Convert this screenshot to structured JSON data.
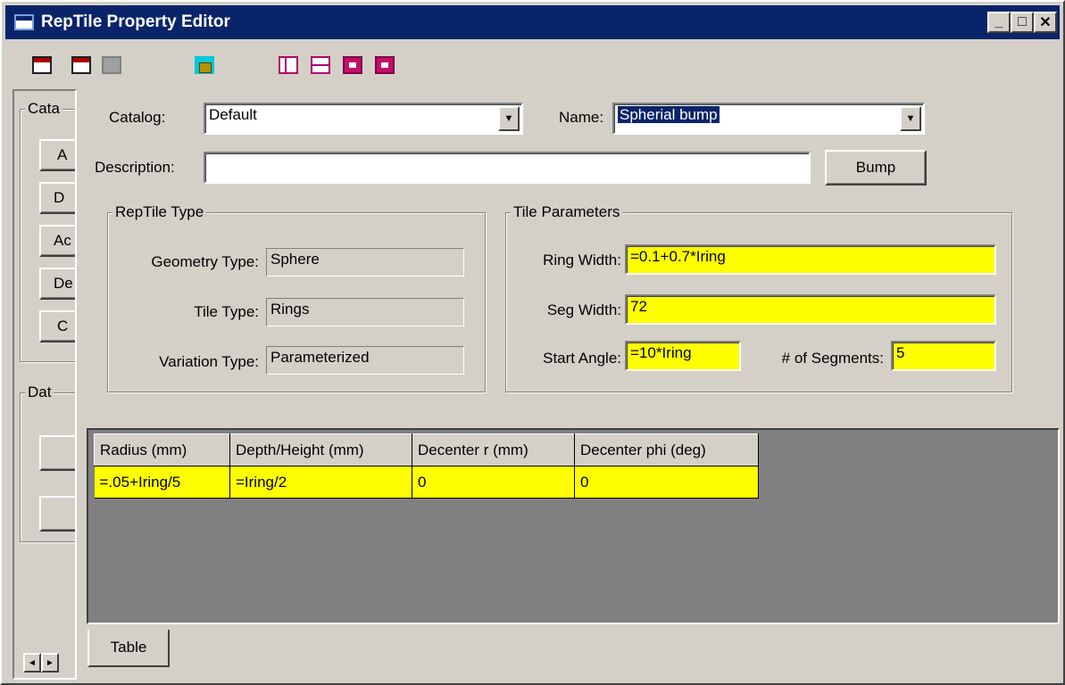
{
  "window": {
    "title": "RepTile Property Editor",
    "minimize_glyph": "_",
    "maximize_glyph": "□",
    "close_glyph": "✕"
  },
  "toolbar": {
    "buttons": [
      "import-icon",
      "export-icon",
      "save-icon",
      "lock-icon",
      "layout-vertical-icon",
      "layout-horizontal-icon",
      "move-down-icon",
      "move-up-icon"
    ]
  },
  "left_pane": {
    "catalog_group_label": "Cata",
    "catalog_buttons": [
      "A",
      "D",
      "Ac",
      "De",
      "C"
    ],
    "data_group_label": "Dat",
    "scroll_left": "◄",
    "scroll_right": "►"
  },
  "form": {
    "catalog_label": "Catalog:",
    "catalog_value": "Default",
    "name_label": "Name:",
    "name_value": "Spherial bump",
    "description_label": "Description:",
    "description_value": "",
    "bump_button": "Bump",
    "combo_arrow": "▼"
  },
  "reptile_type": {
    "legend": "RepTile Type",
    "geometry_label": "Geometry Type:",
    "geometry_value": "Sphere",
    "tile_label": "Tile Type:",
    "tile_value": "Rings",
    "variation_label": "Variation Type:",
    "variation_value": "Parameterized"
  },
  "tile_parameters": {
    "legend": "Tile Parameters",
    "ring_width_label": "Ring Width:",
    "ring_width_value": "=0.1+0.7*Iring",
    "seg_width_label": "Seg Width:",
    "seg_width_value": "72",
    "start_angle_label": "Start Angle:",
    "start_angle_value": "=10*Iring",
    "segments_label": "# of Segments:",
    "segments_value": "5"
  },
  "table": {
    "headers": [
      "Radius (mm)",
      "Depth/Height (mm)",
      "Decenter r (mm)",
      "Decenter phi (deg)"
    ],
    "rows": [
      [
        "=.05+Iring/5",
        "=Iring/2",
        "0",
        "0"
      ]
    ]
  },
  "tabs": [
    "Table"
  ],
  "colors": {
    "title_bar": "#0a246a",
    "window_face": "#d4d0c8",
    "highlight_field": "#ffff00",
    "grid_background": "#808080"
  }
}
